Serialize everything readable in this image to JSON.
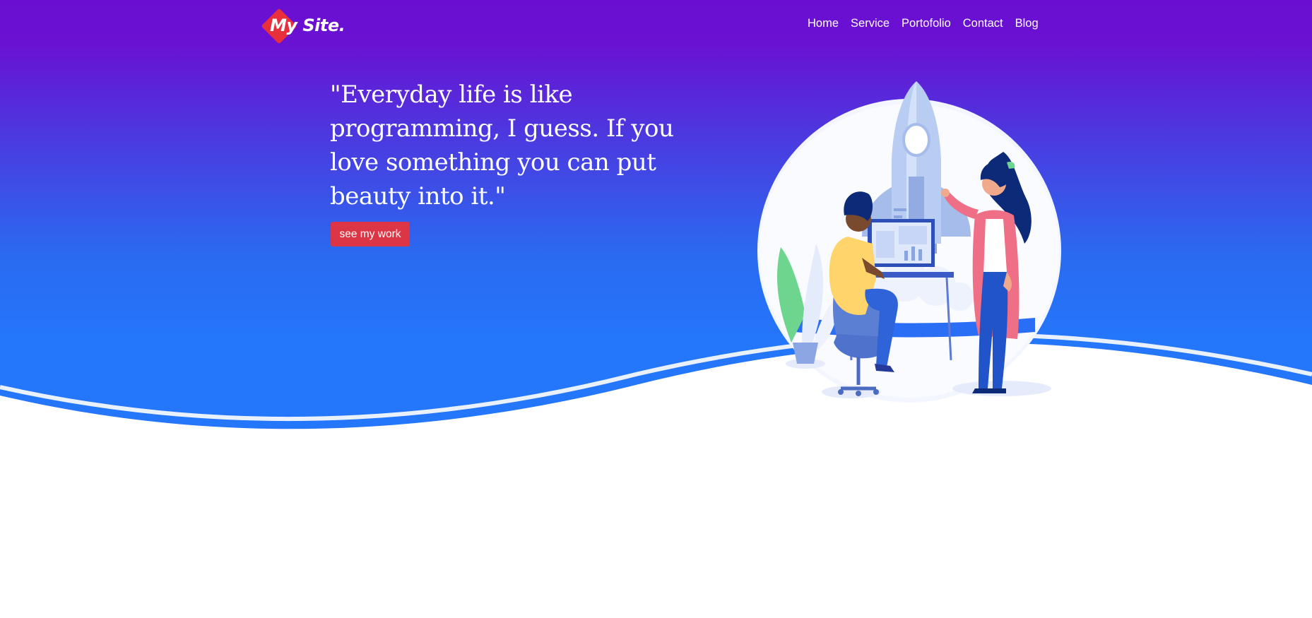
{
  "brand": {
    "name": "My Site."
  },
  "nav": {
    "items": [
      {
        "label": "Home"
      },
      {
        "label": "Service"
      },
      {
        "label": "Portofolio"
      },
      {
        "label": "Contact"
      },
      {
        "label": "Blog"
      }
    ]
  },
  "hero": {
    "quote": "\"Everyday life is like programming, I guess. If you love something you can put beauty into it.\"",
    "cta_label": "see my work",
    "illustration": "rocket-launch-team-illustration"
  },
  "colors": {
    "gradient_top": "#6a11d2",
    "gradient_bottom": "#2476fb",
    "accent_red": "#dc3545",
    "brand_red": "#e8303c",
    "text_white": "#ffffff"
  }
}
